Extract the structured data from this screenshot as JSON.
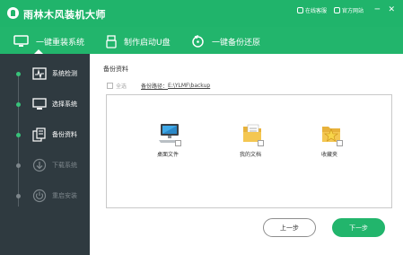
{
  "app": {
    "title": "雨林木风装机大师"
  },
  "titlebar": {
    "online_service": "在线客服",
    "official_site": "官方网站",
    "minimize_glyph": "─",
    "close_glyph": "✕"
  },
  "nav": {
    "items": [
      {
        "label": "一键重装系统",
        "icon": "monitor-icon",
        "active": true
      },
      {
        "label": "制作启动U盘",
        "icon": "usb-drive-icon",
        "active": false
      },
      {
        "label": "一键备份还原",
        "icon": "backup-restore-icon",
        "active": false
      }
    ]
  },
  "sidebar": {
    "steps": [
      {
        "label": "系统检测",
        "icon": "pulse-monitor-icon",
        "state": "done"
      },
      {
        "label": "选择系统",
        "icon": "desktop-icon",
        "state": "done"
      },
      {
        "label": "备份资料",
        "icon": "copy-files-icon",
        "state": "current"
      },
      {
        "label": "下载系统",
        "icon": "download-icon",
        "state": "disabled"
      },
      {
        "label": "重启安装",
        "icon": "restart-icon",
        "state": "disabled"
      }
    ]
  },
  "main": {
    "section_title": "备份资料",
    "select_all": "全选",
    "backup_path_label": "备份路径：",
    "backup_path_value": "E:\\YLMF\\backup",
    "files": [
      {
        "label": "桌面文件",
        "icon": "desktop-computer-icon"
      },
      {
        "label": "我的文档",
        "icon": "documents-folder-icon"
      },
      {
        "label": "收藏夹",
        "icon": "favorites-folder-icon"
      }
    ],
    "prev_button": "上一步",
    "next_button": "下一步"
  },
  "colors": {
    "accent": "#22b56c",
    "sidebar_bg": "#2f3a40",
    "disabled": "#7d868b"
  }
}
